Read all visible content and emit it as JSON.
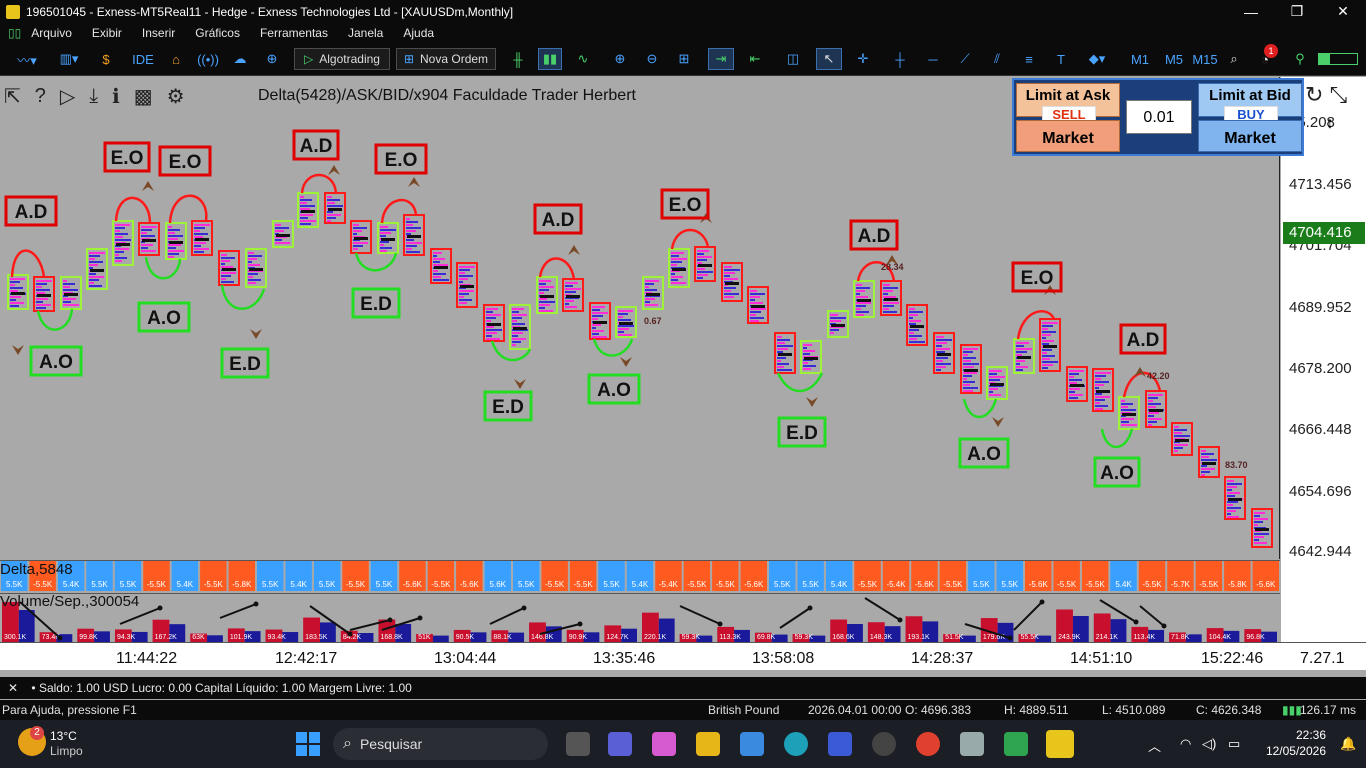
{
  "window": {
    "title": "196501045 - Exness-MT5Real11 - Hedge - Exness Technologies Ltd - [XAUUSDm,Monthly]"
  },
  "menu": [
    "Arquivo",
    "Exibir",
    "Inserir",
    "Gráficos",
    "Ferramentas",
    "Janela",
    "Ajuda"
  ],
  "toolbar": {
    "ide": "IDE",
    "algotrading": "Algotrading",
    "nova_ordem": "Nova Ordem",
    "timeframes": [
      "M1",
      "M5",
      "M15"
    ],
    "notif_count": "1"
  },
  "chart": {
    "indicator_title": "Delta(5428)/ASK/BID/x904   Faculdade Trader Herbert",
    "price_labels": [
      "25.208",
      "4713.456",
      "4701.704",
      "4689.952",
      "4678.200",
      "4666.448",
      "4654.696",
      "4642.944"
    ],
    "current_price": "4704.416",
    "annotations": [
      {
        "text": "A.D",
        "color": "red"
      },
      {
        "text": "E.O",
        "color": "red"
      },
      {
        "text": "E.O",
        "color": "red"
      },
      {
        "text": "A.D",
        "color": "red"
      },
      {
        "text": "E.O",
        "color": "red"
      },
      {
        "text": "E.O",
        "color": "red"
      },
      {
        "text": "A.D",
        "color": "red"
      },
      {
        "text": "A.D",
        "color": "red"
      },
      {
        "text": "E.O",
        "color": "red"
      },
      {
        "text": "A.D",
        "color": "red"
      },
      {
        "text": "A.O",
        "color": "green"
      },
      {
        "text": "A.O",
        "color": "green"
      },
      {
        "text": "E.D",
        "color": "green"
      },
      {
        "text": "E.D",
        "color": "green"
      },
      {
        "text": "E.D",
        "color": "green"
      },
      {
        "text": "A.O",
        "color": "green"
      },
      {
        "text": "E.D",
        "color": "green"
      },
      {
        "text": "A.O",
        "color": "green"
      },
      {
        "text": "A.O",
        "color": "green"
      }
    ],
    "small_numbers": [
      "28.34",
      "0.67",
      "42.20",
      "83.70"
    ]
  },
  "trade_panel": {
    "limit_ask": "Limit at Ask",
    "sell": "SELL",
    "market_left": "Market",
    "lot": "0.01",
    "limit_bid": "Limit at Bid",
    "buy": "BUY",
    "market_right": "Market"
  },
  "delta_pane": {
    "label": "Delta,5848",
    "values": [
      "5.5K",
      "-5.5K",
      "5.4K",
      "5.5K",
      "5.5K",
      "-5.5K",
      "5.4K",
      "-5.5K",
      "-5.8K",
      "5.5K",
      "5.4K",
      "5.5K",
      "-5.5K",
      "5.5K",
      "-5.6K",
      "-5.5K",
      "-5.6K",
      "5.6K",
      "5.5K",
      "-5.5K",
      "-5.5K",
      "5.5K",
      "5.4K",
      "-5.4K",
      "-5.5K",
      "-5.5K",
      "-5.6K",
      "5.5K",
      "5.5K",
      "5.4K",
      "-5.5K",
      "-5.4K",
      "-5.6K",
      "-5.5K",
      "5.5K",
      "5.5K",
      "-5.6K",
      "-5.5K",
      "-5.5K",
      "5.4K",
      "-5.5K",
      "-5.7K",
      "-5.5K",
      "-5.8K",
      "-5.6K"
    ]
  },
  "volume_pane": {
    "label": "Volume/Sep.,300054",
    "values": [
      "300.1K",
      "73.4K",
      "99.8K",
      "94.3K",
      "167.2K",
      "63K",
      "101.9K",
      "93.4K",
      "183.5K",
      "84.2K",
      "168.8K",
      "51K",
      "90.5K",
      "88.1K",
      "146.8K",
      "90.9K",
      "124.7K",
      "220.1K",
      "59.3K",
      "113.3K",
      "69.8K",
      "59.3K",
      "168.6K",
      "148.3K",
      "193.1K",
      "51.5K",
      "179.6K",
      "55.5K",
      "243.9K",
      "214.1K",
      "113.4K",
      "71.8K",
      "104.4K",
      "96.8K"
    ]
  },
  "time_labels": [
    "11:44:22",
    "12:42:17",
    "13:04:44",
    "13:35:46",
    "13:58:08",
    "14:28:37",
    "14:51:10",
    "15:22:46",
    "7.27.1"
  ],
  "account": "•  Saldo: 1.00 USD  Lucro: 0.00  Capital Líquido: 1.00  Margem Livre: 1.00",
  "status": {
    "help": "Para Ajuda, pressione F1",
    "profile": "British Pound",
    "date": "2026.04.01 00:00",
    "open": "O: 4696.383",
    "high": "H: 4889.511",
    "low": "L: 4510.089",
    "close": "C: 4626.348",
    "ping": "126.17 ms"
  },
  "taskbar": {
    "weather_temp": "13°C",
    "weather_desc": "Limpo",
    "weather_badge": "2",
    "search": "Pesquisar",
    "time": "22:36",
    "date": "12/05/2026"
  },
  "colors": {
    "chart_bg": "#a9a9a9",
    "bull_delta": "#3aa0ff",
    "bear_delta": "#ff5a1f",
    "price_tag": "#1a7d1a",
    "annot_red": "#e00000",
    "annot_green": "#22dd22"
  }
}
